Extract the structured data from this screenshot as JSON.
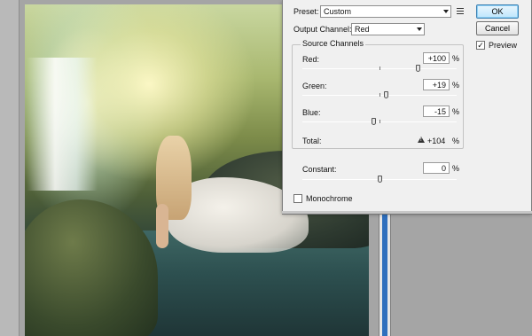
{
  "dialog": {
    "preset_label": "Preset:",
    "preset_value": "Custom",
    "output_channel_label": "Output Channel:",
    "output_channel_value": "Red",
    "ok_label": "OK",
    "cancel_label": "Cancel",
    "preview_label": "Preview",
    "preview_checked": true,
    "source_channels_title": "Source Channels",
    "channels": [
      {
        "label": "Red:",
        "value": "+100",
        "unit": "%",
        "level": 100
      },
      {
        "label": "Green:",
        "value": "+19",
        "unit": "%",
        "level": 19
      },
      {
        "label": "Blue:",
        "value": "-15",
        "unit": "%",
        "level": -15
      }
    ],
    "total_label": "Total:",
    "total_value": "+104",
    "total_unit": "%",
    "constant_label": "Constant:",
    "constant_value": "0",
    "constant_unit": "%",
    "constant_level": 0,
    "monochrome_label": "Monochrome",
    "monochrome_checked": false
  },
  "icons": {
    "preset_menu": "list-menu-icon",
    "total_warning": "warning-triangle-icon",
    "combo_arrow": "chevron-down-icon"
  },
  "colors": {
    "ok_button_accent": "#3c7fb1",
    "dialog_bg": "#f0f0f0"
  }
}
